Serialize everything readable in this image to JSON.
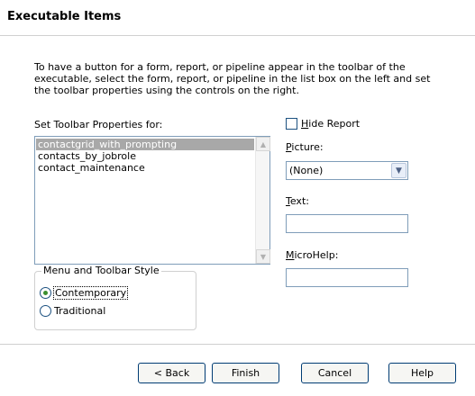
{
  "window": {
    "title": "Executable Items"
  },
  "description": "To have a button for a form, report, or pipeline appear in the toolbar of the executable, select the form, report, or pipeline in the list box on the left and set the toolbar properties using the controls on the right.",
  "list": {
    "label": "Set Toolbar Properties for:",
    "items": [
      "contactgrid_with_prompting",
      "contacts_by_jobrole",
      "contact_maintenance"
    ],
    "selected_index": 0
  },
  "style_group": {
    "legend": "Menu and Toolbar Style",
    "options": [
      "Contemporary",
      "Traditional"
    ],
    "selected": "Contemporary"
  },
  "hide_report": {
    "label_accel": "H",
    "label_rest": "ide Report",
    "checked": false
  },
  "picture": {
    "label_accel": "P",
    "label_rest": "icture:",
    "value": "(None)"
  },
  "text_field": {
    "label_accel": "T",
    "label_rest": "ext:",
    "value": ""
  },
  "microhelp": {
    "label_accel": "M",
    "label_rest": "icroHelp:",
    "value": ""
  },
  "buttons": {
    "back": "< Back",
    "finish": "Finish",
    "cancel": "Cancel",
    "help": "Help"
  },
  "icons": {
    "scroll_up": "chevron-up-icon",
    "scroll_down": "chevron-down-icon",
    "dropdown": "chevron-down-icon"
  },
  "colors": {
    "selection": "#a8a8a8",
    "control_border": "#7f9db9",
    "button_border": "#003c74"
  }
}
